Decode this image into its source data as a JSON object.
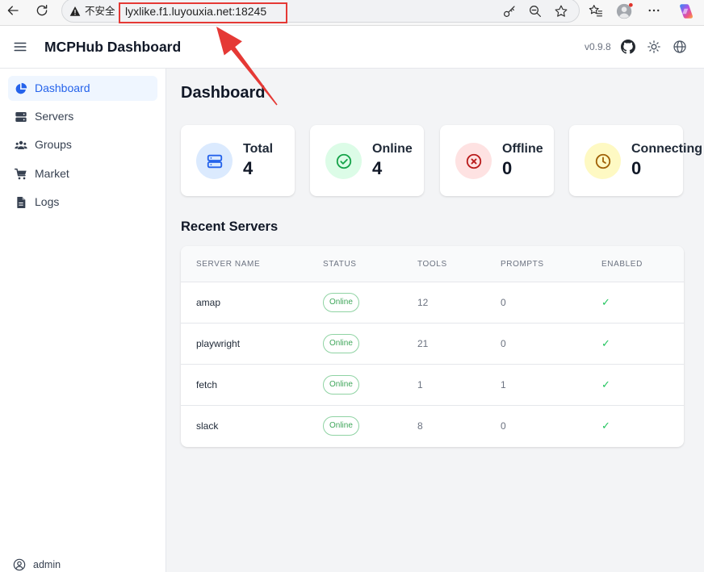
{
  "browser": {
    "security_label": "不安全",
    "url": "lyxlike.f1.luyouxia.net:18245",
    "icons": [
      "back-icon",
      "refresh-icon",
      "warning-icon",
      "key-icon",
      "zoom-out-icon",
      "star-icon",
      "favorites-icon",
      "profile-avatar-icon",
      "more-icon",
      "copilot-icon"
    ]
  },
  "annotation": {
    "color": "#e53935"
  },
  "header": {
    "title": "MCPHub Dashboard",
    "version": "v0.9.8",
    "icons": [
      "menu-icon",
      "github-icon",
      "sun-icon",
      "globe-icon"
    ]
  },
  "sidebar": {
    "items": [
      {
        "label": "Dashboard",
        "icon": "pie-chart-icon",
        "active": true
      },
      {
        "label": "Servers",
        "icon": "server-icon",
        "active": false
      },
      {
        "label": "Groups",
        "icon": "users-icon",
        "active": false
      },
      {
        "label": "Market",
        "icon": "cart-icon",
        "active": false
      },
      {
        "label": "Logs",
        "icon": "file-icon",
        "active": false
      }
    ],
    "user": {
      "name": "admin",
      "icon": "user-icon"
    },
    "active_color": "#2563eb",
    "active_bg": "#eff6ff"
  },
  "main": {
    "title": "Dashboard",
    "stats": [
      {
        "label": "Total",
        "value": 4,
        "icon": "server-icon",
        "color": "#2563eb",
        "bg": "#dbeafe"
      },
      {
        "label": "Online",
        "value": 4,
        "icon": "check-circle-icon",
        "color": "#16a34a",
        "bg": "#dcfce7"
      },
      {
        "label": "Offline",
        "value": 0,
        "icon": "x-circle-icon",
        "color": "#b91c1c",
        "bg": "#fee2e2"
      },
      {
        "label": "Connecting",
        "value": 0,
        "icon": "clock-icon",
        "color": "#a16207",
        "bg": "#fef9c3"
      }
    ],
    "recent_title": "Recent Servers",
    "table": {
      "columns": [
        "SERVER NAME",
        "STATUS",
        "TOOLS",
        "PROMPTS",
        "ENABLED"
      ],
      "rows": [
        {
          "name": "amap",
          "status": "Online",
          "tools": 12,
          "prompts": 0,
          "enabled": "✓"
        },
        {
          "name": "playwright",
          "status": "Online",
          "tools": 21,
          "prompts": 0,
          "enabled": "✓"
        },
        {
          "name": "fetch",
          "status": "Online",
          "tools": 1,
          "prompts": 1,
          "enabled": "✓"
        },
        {
          "name": "slack",
          "status": "Online",
          "tools": 8,
          "prompts": 0,
          "enabled": "✓"
        }
      ],
      "status_color": "#3fa65a"
    }
  }
}
